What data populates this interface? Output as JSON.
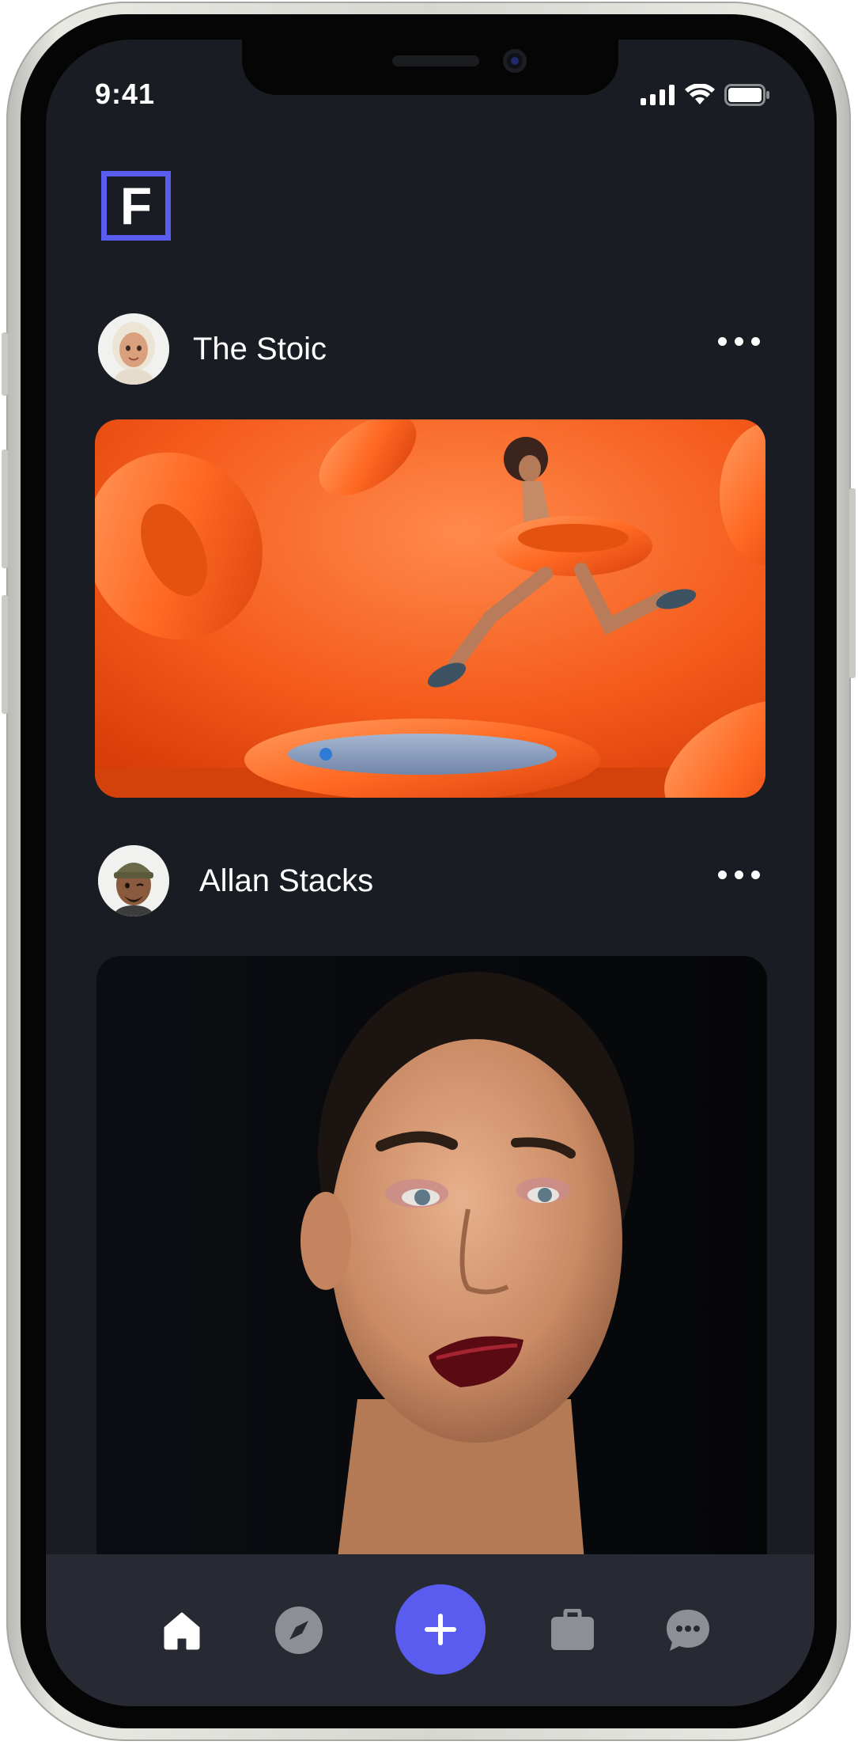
{
  "status_bar": {
    "time": "9:41"
  },
  "app": {
    "logo_letter": "F",
    "accent_color": "#5a5cf0"
  },
  "feed": {
    "posts": [
      {
        "author": "The Stoic",
        "image": "orange pool float photo"
      },
      {
        "author": "Allan Stacks",
        "image": "beauty portrait photo"
      }
    ]
  },
  "tab_bar": {
    "items": [
      {
        "icon": "home-icon",
        "active": true
      },
      {
        "icon": "compass-icon",
        "active": false
      },
      {
        "icon": "plus-icon",
        "active": false
      },
      {
        "icon": "briefcase-icon",
        "active": false
      },
      {
        "icon": "chat-icon",
        "active": false
      }
    ]
  }
}
